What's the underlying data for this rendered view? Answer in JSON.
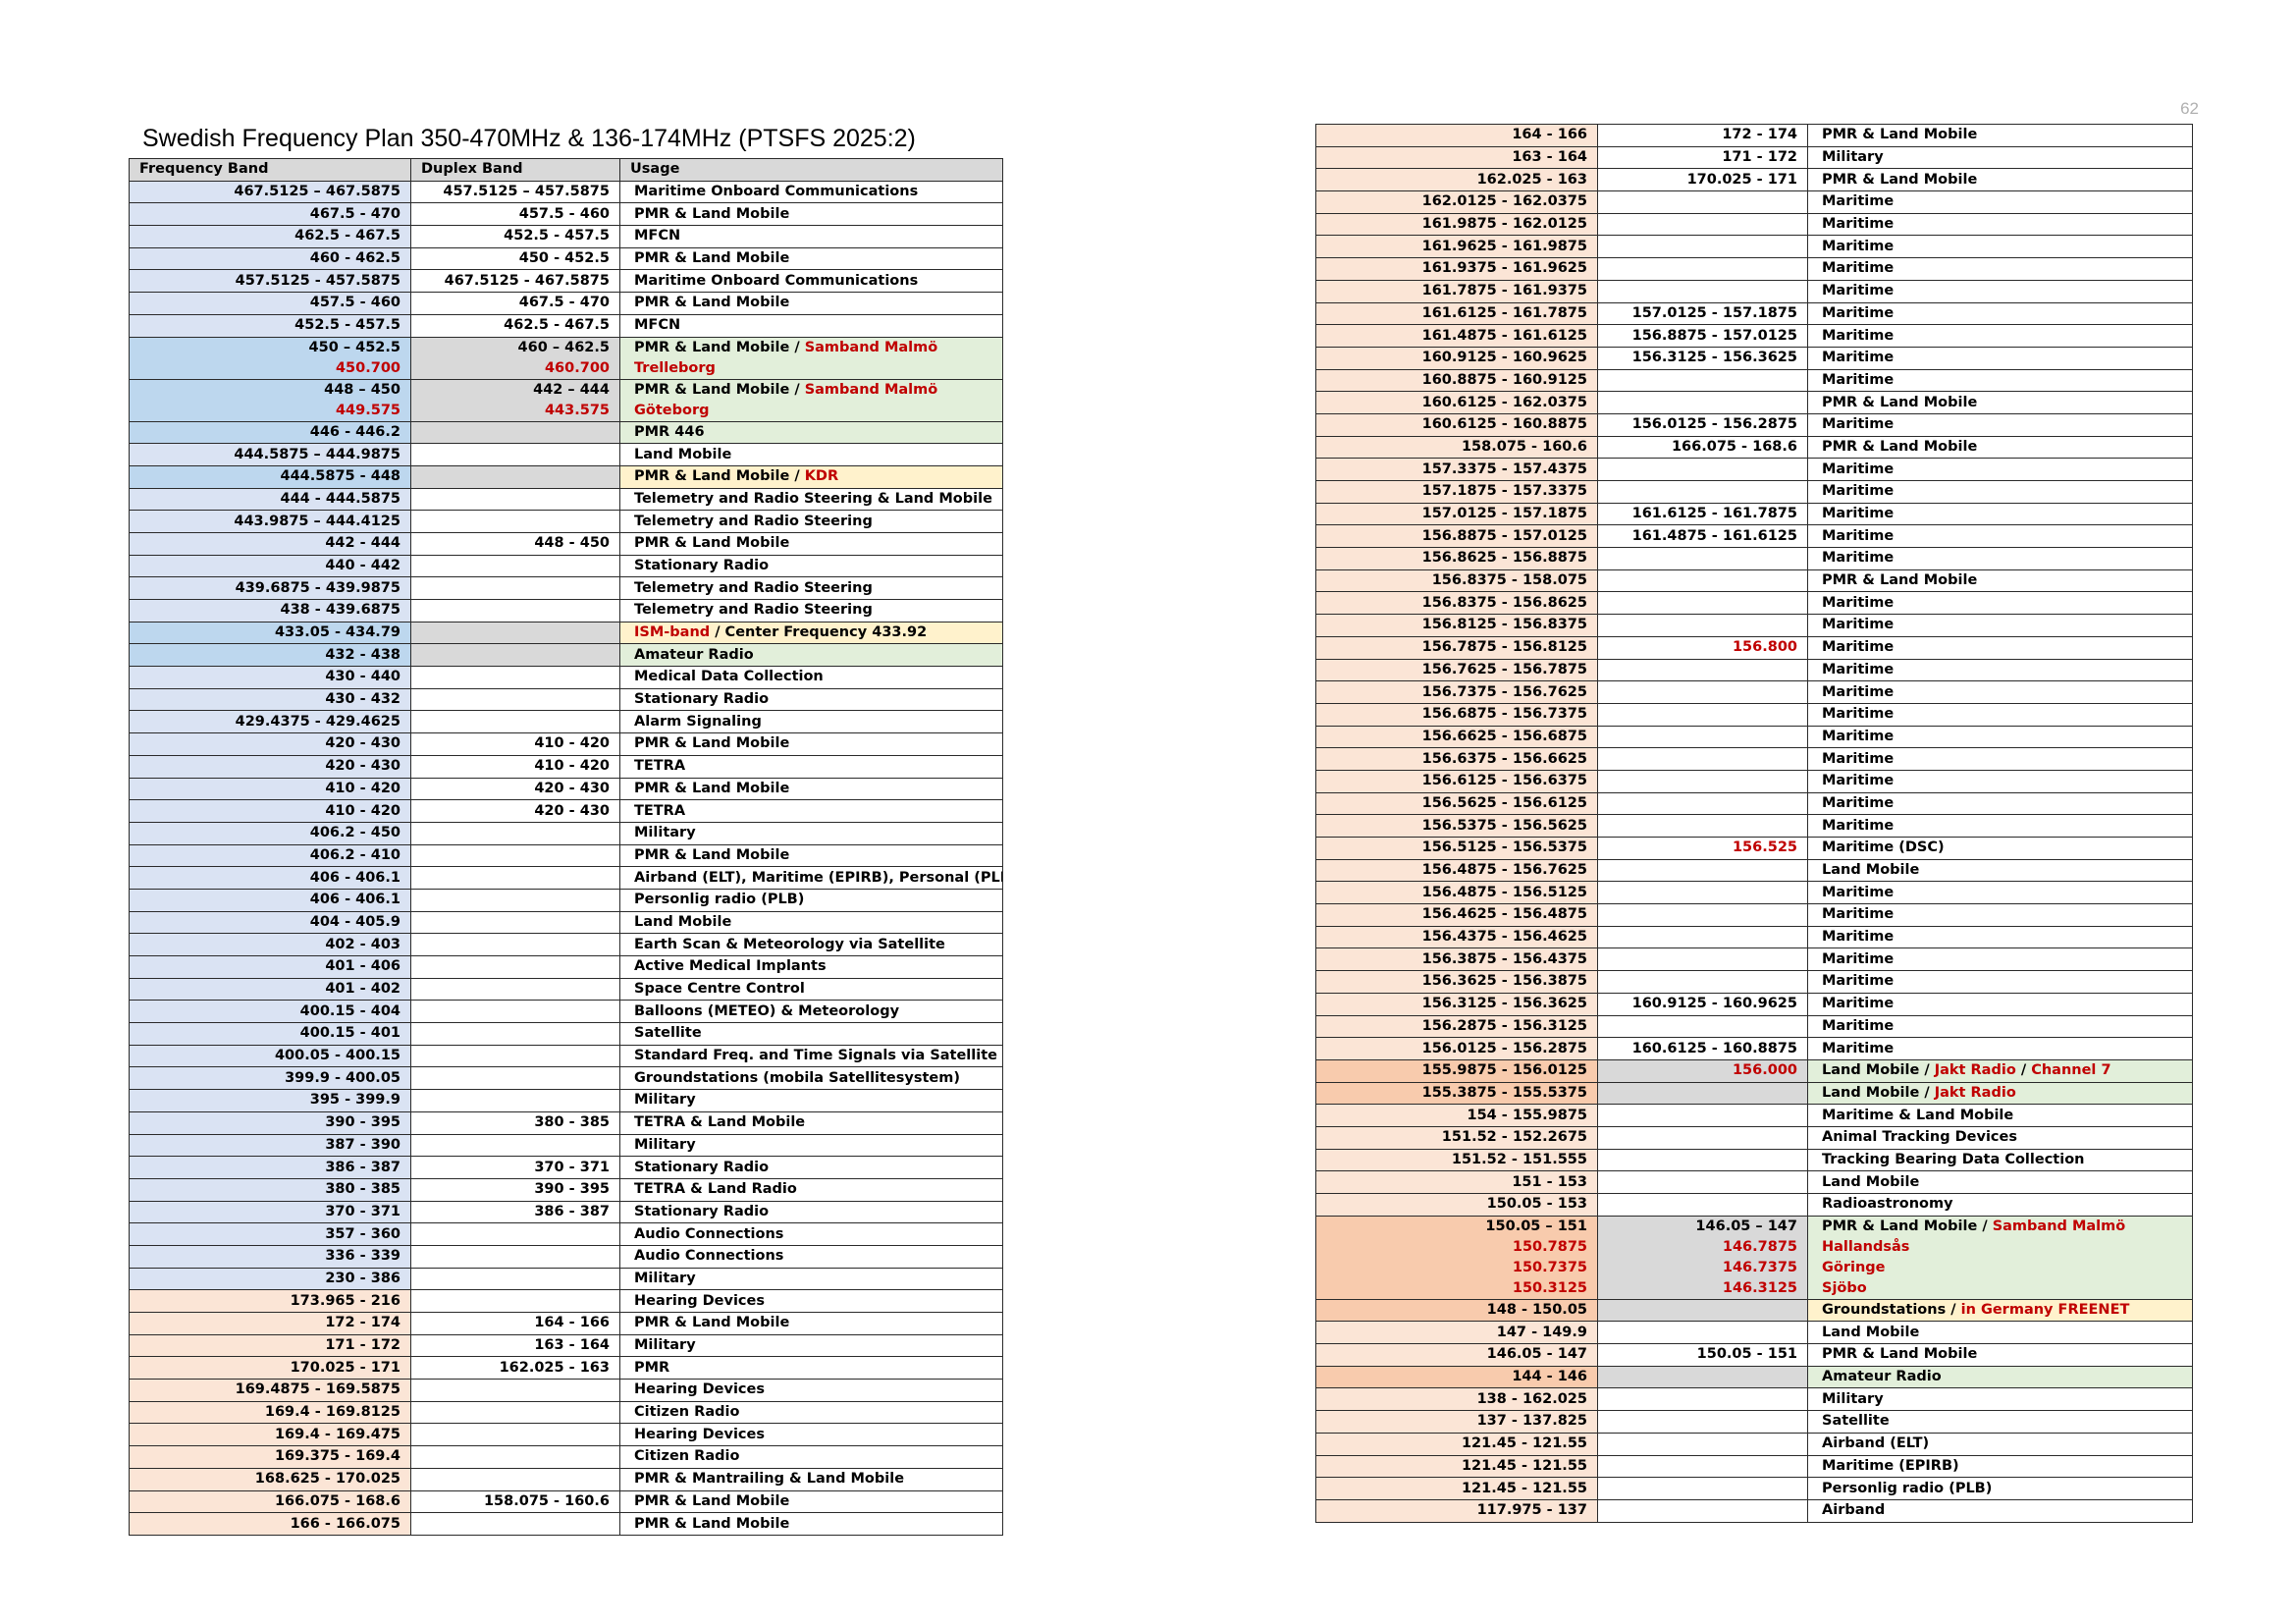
{
  "page": {
    "title": "Swedish Frequency Plan 350-470MHz & 136-174MHz (PTSFS 2025:2)",
    "page_number": "62"
  },
  "colors": {
    "blue": "#dae3f3",
    "blue_mid": "#bdd7ee",
    "peach": "#fbe5d6",
    "peach_dark": "#f8cbad",
    "gray": "#d9d9d9",
    "green": "#e2efda",
    "yellow": "#fff2cc",
    "white": "#ffffff",
    "red_text": "#c00000"
  },
  "left_table": {
    "headers": [
      "Frequency Band",
      "Duplex Band",
      "Usage"
    ],
    "rows": [
      {
        "band": "467.5125 – 467.5875",
        "duplex": "457.5125 – 457.5875",
        "usage": "Maritime Onboard Communications",
        "bc": "blue"
      },
      {
        "band": "467.5 - 470",
        "duplex": "457.5 - 460",
        "usage": "PMR & Land Mobile",
        "bc": "blue"
      },
      {
        "band": "462.5 - 467.5",
        "duplex": "452.5 - 457.5",
        "usage": "MFCN",
        "bc": "blue"
      },
      {
        "band": "460 - 462.5",
        "duplex": "450 - 452.5",
        "usage": "PMR & Land Mobile",
        "bc": "blue"
      },
      {
        "band": "457.5125 - 457.5875",
        "duplex": "467.5125 - 467.5875",
        "usage": "Maritime Onboard Communications",
        "bc": "blue"
      },
      {
        "band": "457.5 - 460",
        "duplex": "467.5 - 470",
        "usage": "PMR & Land Mobile",
        "bc": "blue"
      },
      {
        "band": "452.5 - 457.5",
        "duplex": "462.5 - 467.5",
        "usage": "MFCN",
        "bc": "blue"
      },
      {
        "band": "450 – 452.5",
        "band_sub": "450.700",
        "duplex": "460 – 462.5",
        "duplex_sub": "460.700",
        "usage": "PMR & Land Mobile / ",
        "usage_red": "Samband Malmö",
        "usage_sub": "Trelleborg",
        "bc": "blue_mid",
        "dc": "gray",
        "uc": "green"
      },
      {
        "band": "448 – 450",
        "band_sub": "449.575",
        "duplex": "442 – 444",
        "duplex_sub": "443.575",
        "usage": "PMR & Land Mobile / ",
        "usage_red": "Samband Malmö",
        "usage_sub": "Göteborg",
        "bc": "blue_mid",
        "dc": "gray",
        "uc": "green"
      },
      {
        "band": "446 - 446.2",
        "duplex": "",
        "usage": "PMR 446",
        "bc": "blue_mid",
        "dc": "gray",
        "uc": "green"
      },
      {
        "band": "444.5875 – 444.9875",
        "duplex": "",
        "usage": "Land Mobile",
        "bc": "blue"
      },
      {
        "band": "444.5875 - 448",
        "duplex": "",
        "usage": "PMR & Land Mobile / ",
        "usage_red": "KDR",
        "bc": "blue_mid",
        "dc": "gray",
        "uc": "yellow"
      },
      {
        "band": "444 - 444.5875",
        "duplex": "",
        "usage": "Telemetry and Radio Steering & Land Mobile",
        "bc": "blue"
      },
      {
        "band": "443.9875 – 444.4125",
        "duplex": "",
        "usage": "Telemetry and Radio Steering",
        "bc": "blue"
      },
      {
        "band": "442 - 444",
        "duplex": "448 - 450",
        "usage": "PMR & Land Mobile",
        "bc": "blue"
      },
      {
        "band": "440 - 442",
        "duplex": "",
        "usage": "Stationary Radio",
        "bc": "blue"
      },
      {
        "band": "439.6875 - 439.9875",
        "duplex": "",
        "usage": "Telemetry and Radio Steering",
        "bc": "blue"
      },
      {
        "band": "438 - 439.6875",
        "duplex": "",
        "usage": "Telemetry and Radio Steering",
        "bc": "blue"
      },
      {
        "band": "433.05 - 434.79",
        "duplex": "",
        "usage_red_first": "ISM-band",
        "usage": " / Center Frequency 433.92",
        "bc": "blue_mid",
        "dc": "gray",
        "uc": "yellow"
      },
      {
        "band": "432 - 438",
        "duplex": "",
        "usage": "Amateur Radio",
        "bc": "blue_mid",
        "dc": "gray",
        "uc": "green"
      },
      {
        "band": "430 - 440",
        "duplex": "",
        "usage": "Medical Data Collection",
        "bc": "blue"
      },
      {
        "band": "430 - 432",
        "duplex": "",
        "usage": "Stationary Radio",
        "bc": "blue"
      },
      {
        "band": "429.4375 - 429.4625",
        "duplex": "",
        "usage": "Alarm Signaling",
        "bc": "blue"
      },
      {
        "band": "420 - 430",
        "duplex": "410 - 420",
        "usage": "PMR & Land Mobile",
        "bc": "blue"
      },
      {
        "band": "420 - 430",
        "duplex": "410 - 420",
        "usage": "TETRA",
        "bc": "blue"
      },
      {
        "band": "410 - 420",
        "duplex": "420 - 430",
        "usage": "PMR & Land Mobile",
        "bc": "blue"
      },
      {
        "band": "410 - 420",
        "duplex": "420 - 430",
        "usage": "TETRA",
        "bc": "blue"
      },
      {
        "band": "406.2 - 450",
        "duplex": "",
        "usage": "Military",
        "bc": "blue"
      },
      {
        "band": "406.2 - 410",
        "duplex": "",
        "usage": "PMR & Land Mobile",
        "bc": "blue"
      },
      {
        "band": "406 - 406.1",
        "duplex": "",
        "usage": "Airband (ELT), Maritime (EPIRB), Personal (PLB)",
        "bc": "blue"
      },
      {
        "band": "406 - 406.1",
        "duplex": "",
        "usage": "Personlig radio (PLB)",
        "bc": "blue"
      },
      {
        "band": "404 - 405.9",
        "duplex": "",
        "usage": "Land Mobile",
        "bc": "blue"
      },
      {
        "band": "402 - 403",
        "duplex": "",
        "usage": "Earth Scan & Meteorology via Satellite",
        "bc": "blue"
      },
      {
        "band": "401 - 406",
        "duplex": "",
        "usage": "Active Medical Implants",
        "bc": "blue"
      },
      {
        "band": "401 - 402",
        "duplex": "",
        "usage": "Space Centre Control",
        "bc": "blue"
      },
      {
        "band": "400.15 - 404",
        "duplex": "",
        "usage": "Balloons (METEO) & Meteorology",
        "bc": "blue"
      },
      {
        "band": "400.15 - 401",
        "duplex": "",
        "usage": "Satellite",
        "bc": "blue"
      },
      {
        "band": "400.05 - 400.15",
        "duplex": "",
        "usage": "Standard Freq. and Time Signals via Satellite",
        "bc": "blue"
      },
      {
        "band": "399.9 - 400.05",
        "duplex": "",
        "usage": "Groundstations (mobila Satellitesystem)",
        "bc": "blue"
      },
      {
        "band": "395 - 399.9",
        "duplex": "",
        "usage": "Military",
        "bc": "blue"
      },
      {
        "band": "390 - 395",
        "duplex": "380 - 385",
        "usage": "TETRA & Land Mobile",
        "bc": "blue"
      },
      {
        "band": "387 - 390",
        "duplex": "",
        "usage": "Military",
        "bc": "blue"
      },
      {
        "band": "386 - 387",
        "duplex": "370 - 371",
        "usage": "Stationary Radio",
        "bc": "blue"
      },
      {
        "band": "380 - 385",
        "duplex": "390 - 395",
        "usage": "TETRA & Land Radio",
        "bc": "blue"
      },
      {
        "band": "370 - 371",
        "duplex": "386 - 387",
        "usage": "Stationary Radio",
        "bc": "blue"
      },
      {
        "band": "357 - 360",
        "duplex": "",
        "usage": "Audio Connections",
        "bc": "blue"
      },
      {
        "band": "336 - 339",
        "duplex": "",
        "usage": "Audio Connections",
        "bc": "blue"
      },
      {
        "band": "230 - 386",
        "duplex": "",
        "usage": "Military",
        "bc": "blue"
      },
      {
        "band": "173.965 - 216",
        "duplex": "",
        "usage": "Hearing Devices",
        "bc": "peach"
      },
      {
        "band": "172 - 174",
        "duplex": "164 - 166",
        "usage": "PMR & Land Mobile",
        "bc": "peach"
      },
      {
        "band": "171 - 172",
        "duplex": "163 - 164",
        "usage": "Military",
        "bc": "peach"
      },
      {
        "band": "170.025 - 171",
        "duplex": "162.025 - 163",
        "usage": "PMR",
        "bc": "peach"
      },
      {
        "band": "169.4875 - 169.5875",
        "duplex": "",
        "usage": "Hearing Devices",
        "bc": "peach"
      },
      {
        "band": "169.4 - 169.8125",
        "duplex": "",
        "usage": "Citizen Radio",
        "bc": "peach"
      },
      {
        "band": "169.4 - 169.475",
        "duplex": "",
        "usage": "Hearing Devices",
        "bc": "peach"
      },
      {
        "band": "169.375 - 169.4",
        "duplex": "",
        "usage": "Citizen Radio",
        "bc": "peach"
      },
      {
        "band": "168.625 - 170.025",
        "duplex": "",
        "usage": "PMR & Mantrailing & Land Mobile",
        "bc": "peach"
      },
      {
        "band": "166.075 - 168.6",
        "duplex": "158.075 - 160.6",
        "usage": "PMR & Land Mobile",
        "bc": "peach"
      },
      {
        "band": "166 - 166.075",
        "duplex": "",
        "usage": "PMR & Land Mobile",
        "bc": "peach"
      }
    ]
  },
  "right_table": {
    "rows": [
      {
        "band": "164 - 166",
        "duplex": "172 - 174",
        "usage": "PMR & Land Mobile",
        "bc": "peach"
      },
      {
        "band": "163 - 164",
        "duplex": "171 - 172",
        "usage": "Military",
        "bc": "peach"
      },
      {
        "band": "162.025 - 163",
        "duplex": "170.025 - 171",
        "usage": "PMR & Land Mobile",
        "bc": "peach"
      },
      {
        "band": "162.0125 - 162.0375",
        "duplex": "",
        "usage": "Maritime",
        "bc": "peach"
      },
      {
        "band": "161.9875 - 162.0125",
        "duplex": "",
        "usage": "Maritime",
        "bc": "peach"
      },
      {
        "band": "161.9625 - 161.9875",
        "duplex": "",
        "usage": "Maritime",
        "bc": "peach"
      },
      {
        "band": "161.9375 - 161.9625",
        "duplex": "",
        "usage": "Maritime",
        "bc": "peach"
      },
      {
        "band": "161.7875 - 161.9375",
        "duplex": "",
        "usage": "Maritime",
        "bc": "peach"
      },
      {
        "band": "161.6125 - 161.7875",
        "duplex": "157.0125 - 157.1875",
        "usage": "Maritime",
        "bc": "peach"
      },
      {
        "band": "161.4875 - 161.6125",
        "duplex": "156.8875 - 157.0125",
        "usage": "Maritime",
        "bc": "peach"
      },
      {
        "band": "160.9125 - 160.9625",
        "duplex": "156.3125 - 156.3625",
        "usage": "Maritime",
        "bc": "peach"
      },
      {
        "band": "160.8875 - 160.9125",
        "duplex": "",
        "usage": "Maritime",
        "bc": "peach"
      },
      {
        "band": "160.6125 - 162.0375",
        "duplex": "",
        "usage": "PMR & Land Mobile",
        "bc": "peach"
      },
      {
        "band": "160.6125 - 160.8875",
        "duplex": "156.0125 - 156.2875",
        "usage": "Maritime",
        "bc": "peach"
      },
      {
        "band": "158.075 - 160.6",
        "duplex": "166.075 - 168.6",
        "usage": "PMR & Land Mobile",
        "bc": "peach"
      },
      {
        "band": "157.3375 - 157.4375",
        "duplex": "",
        "usage": "Maritime",
        "bc": "peach"
      },
      {
        "band": "157.1875 - 157.3375",
        "duplex": "",
        "usage": "Maritime",
        "bc": "peach"
      },
      {
        "band": "157.0125 - 157.1875",
        "duplex": "161.6125 - 161.7875",
        "usage": "Maritime",
        "bc": "peach"
      },
      {
        "band": "156.8875 - 157.0125",
        "duplex": "161.4875 - 161.6125",
        "usage": "Maritime",
        "bc": "peach"
      },
      {
        "band": "156.8625 - 156.8875",
        "duplex": "",
        "usage": "Maritime",
        "bc": "peach"
      },
      {
        "band": "156.8375 - 158.075",
        "duplex": "",
        "usage": "PMR & Land Mobile",
        "bc": "peach"
      },
      {
        "band": "156.8375 - 156.8625",
        "duplex": "",
        "usage": "Maritime",
        "bc": "peach"
      },
      {
        "band": "156.8125 - 156.8375",
        "duplex": "",
        "usage": "Maritime",
        "bc": "peach"
      },
      {
        "band": "156.7875 - 156.8125",
        "duplex": "",
        "duplex_red": "156.800",
        "usage": "Maritime",
        "bc": "peach"
      },
      {
        "band": "156.7625 - 156.7875",
        "duplex": "",
        "usage": "Maritime",
        "bc": "peach"
      },
      {
        "band": "156.7375 - 156.7625",
        "duplex": "",
        "usage": "Maritime",
        "bc": "peach"
      },
      {
        "band": "156.6875 - 156.7375",
        "duplex": "",
        "usage": "Maritime",
        "bc": "peach"
      },
      {
        "band": "156.6625 - 156.6875",
        "duplex": "",
        "usage": "Maritime",
        "bc": "peach"
      },
      {
        "band": "156.6375 - 156.6625",
        "duplex": "",
        "usage": "Maritime",
        "bc": "peach"
      },
      {
        "band": "156.6125 - 156.6375",
        "duplex": "",
        "usage": "Maritime",
        "bc": "peach"
      },
      {
        "band": "156.5625 - 156.6125",
        "duplex": "",
        "usage": "Maritime",
        "bc": "peach"
      },
      {
        "band": "156.5375 - 156.5625",
        "duplex": "",
        "usage": "Maritime",
        "bc": "peach"
      },
      {
        "band": "156.5125 - 156.5375",
        "duplex": "",
        "duplex_red": "156.525",
        "usage": "Maritime (DSC)",
        "bc": "peach"
      },
      {
        "band": "156.4875 - 156.7625",
        "duplex": "",
        "usage": "Land Mobile",
        "bc": "peach"
      },
      {
        "band": "156.4875 - 156.5125",
        "duplex": "",
        "usage": "Maritime",
        "bc": "peach"
      },
      {
        "band": "156.4625 - 156.4875",
        "duplex": "",
        "usage": "Maritime",
        "bc": "peach"
      },
      {
        "band": "156.4375 - 156.4625",
        "duplex": "",
        "usage": "Maritime",
        "bc": "peach"
      },
      {
        "band": "156.3875 - 156.4375",
        "duplex": "",
        "usage": "Maritime",
        "bc": "peach"
      },
      {
        "band": "156.3625 - 156.3875",
        "duplex": "",
        "usage": "Maritime",
        "bc": "peach"
      },
      {
        "band": "156.3125 - 156.3625",
        "duplex": "160.9125 - 160.9625",
        "usage": "Maritime",
        "bc": "peach"
      },
      {
        "band": "156.2875 - 156.3125",
        "duplex": "",
        "usage": "Maritime",
        "bc": "peach"
      },
      {
        "band": "156.0125 - 156.2875",
        "duplex": "160.6125 - 160.8875",
        "usage": "Maritime",
        "bc": "peach"
      },
      {
        "band": "155.9875 - 156.0125",
        "duplex": "",
        "duplex_red": "156.000",
        "usage": "Land Mobile / ",
        "usage_red": "Jakt Radio",
        "usage_tail": " / ",
        "usage_red2": "Channel 7",
        "bc": "peach_dark",
        "dc": "gray",
        "uc": "green"
      },
      {
        "band": "155.3875 - 155.5375",
        "duplex": "",
        "usage": "Land Mobile / ",
        "usage_red": "Jakt Radio",
        "bc": "peach_dark",
        "dc": "gray",
        "uc": "green"
      },
      {
        "band": "154 - 155.9875",
        "duplex": "",
        "usage": "Maritime & Land Mobile",
        "bc": "peach"
      },
      {
        "band": "151.52 - 152.2675",
        "duplex": "",
        "usage": "Animal Tracking Devices",
        "bc": "peach"
      },
      {
        "band": "151.52 - 151.555",
        "duplex": "",
        "usage": "Tracking Bearing Data Collection",
        "bc": "peach"
      },
      {
        "band": "151 - 153",
        "duplex": "",
        "usage": "Land Mobile",
        "bc": "peach"
      },
      {
        "band": "150.05 - 153",
        "duplex": "",
        "usage": "Radioastronomy",
        "bc": "peach"
      },
      {
        "band": "150.05 – 151",
        "band_subs": [
          "150.7875",
          "150.7375",
          "150.3125"
        ],
        "duplex": "146.05 – 147",
        "duplex_subs": [
          "146.7875",
          "146.7375",
          "146.3125"
        ],
        "usage": "PMR & Land Mobile / ",
        "usage_red": "Samband Malmö",
        "usage_subs": [
          "Hallandsås",
          "Göringe",
          "Sjöbo"
        ],
        "bc": "peach_dark",
        "dc": "gray",
        "uc": "green"
      },
      {
        "band": "148 - 150.05",
        "duplex": "",
        "usage": "Groundstations / ",
        "usage_red": "in Germany FREENET",
        "bc": "peach_dark",
        "dc": "gray",
        "uc": "yellow"
      },
      {
        "band": "147 - 149.9",
        "duplex": "",
        "usage": "Land Mobile",
        "bc": "peach"
      },
      {
        "band": "146.05 - 147",
        "duplex": "150.05 - 151",
        "usage": "PMR & Land Mobile",
        "bc": "peach"
      },
      {
        "band": "144 - 146",
        "duplex": "",
        "usage": "Amateur Radio",
        "bc": "peach_dark",
        "dc": "gray",
        "uc": "green"
      },
      {
        "band": "138 - 162.025",
        "duplex": "",
        "usage": "Military",
        "bc": "peach"
      },
      {
        "band": "137 - 137.825",
        "duplex": "",
        "usage": "Satellite",
        "bc": "peach"
      },
      {
        "band": "121.45 - 121.55",
        "duplex": "",
        "usage": "Airband (ELT)",
        "bc": "peach"
      },
      {
        "band": "121.45 - 121.55",
        "duplex": "",
        "usage": "Maritime (EPIRB)",
        "bc": "peach"
      },
      {
        "band": "121.45 - 121.55",
        "duplex": "",
        "usage": "Personlig radio (PLB)",
        "bc": "peach"
      },
      {
        "band": "117.975 - 137",
        "duplex": "",
        "usage": "Airband",
        "bc": "peach"
      }
    ]
  }
}
